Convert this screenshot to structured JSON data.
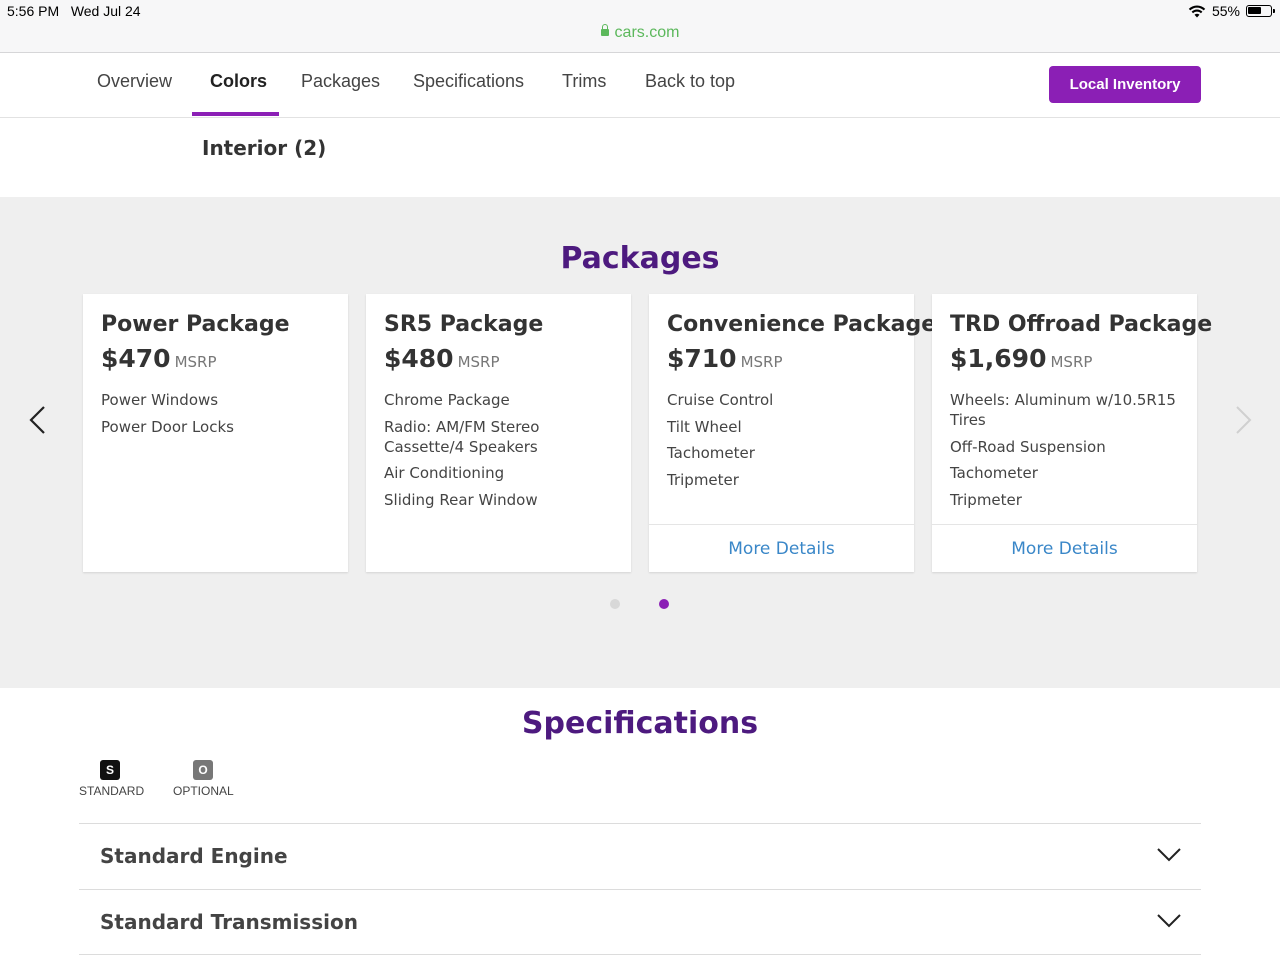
{
  "status_bar": {
    "time": "5:56 PM",
    "date": "Wed Jul 24",
    "battery": "55%",
    "url": "cars.com"
  },
  "nav": {
    "items": [
      {
        "label": "Overview",
        "active": false
      },
      {
        "label": "Colors",
        "active": true
      },
      {
        "label": "Packages",
        "active": false
      },
      {
        "label": "Specifications",
        "active": false
      },
      {
        "label": "Trims",
        "active": false
      },
      {
        "label": "Back to top",
        "active": false
      }
    ],
    "inventory_button": "Local Inventory",
    "accent_color": "#8b1fb5"
  },
  "interior_label": "Interior (2)",
  "packages": {
    "title": "Packages",
    "cards": [
      {
        "name": "Power Package",
        "price": "$470",
        "msrp": "MSRP",
        "features": [
          "Power Windows",
          "Power Door Locks"
        ],
        "more_details": ""
      },
      {
        "name": "SR5 Package",
        "price": "$480",
        "msrp": "MSRP",
        "features": [
          "Chrome Package",
          "Radio: AM/FM Stereo Cassette/4 Speakers",
          "Air Conditioning",
          "Sliding Rear Window"
        ],
        "more_details": ""
      },
      {
        "name": "Convenience Package",
        "price": "$710",
        "msrp": "MSRP",
        "features": [
          "Cruise Control",
          "Tilt Wheel",
          "Tachometer",
          "Tripmeter"
        ],
        "more_details": "More Details"
      },
      {
        "name": "TRD Offroad Package",
        "price": "$1,690",
        "msrp": "MSRP",
        "features": [
          "Wheels: Aluminum w/10.5R15 Tires",
          "Off-Road Suspension",
          "Tachometer",
          "Tripmeter"
        ],
        "more_details": "More Details"
      }
    ],
    "pagination": {
      "pages": 2,
      "current": 2
    }
  },
  "specifications": {
    "title": "Specifications",
    "legend": [
      {
        "badge": "S",
        "label": "STANDARD",
        "color": "#111111"
      },
      {
        "badge": "O",
        "label": "OPTIONAL",
        "color": "#777777"
      }
    ],
    "rows": [
      "Standard Engine",
      "Standard Transmission"
    ]
  }
}
